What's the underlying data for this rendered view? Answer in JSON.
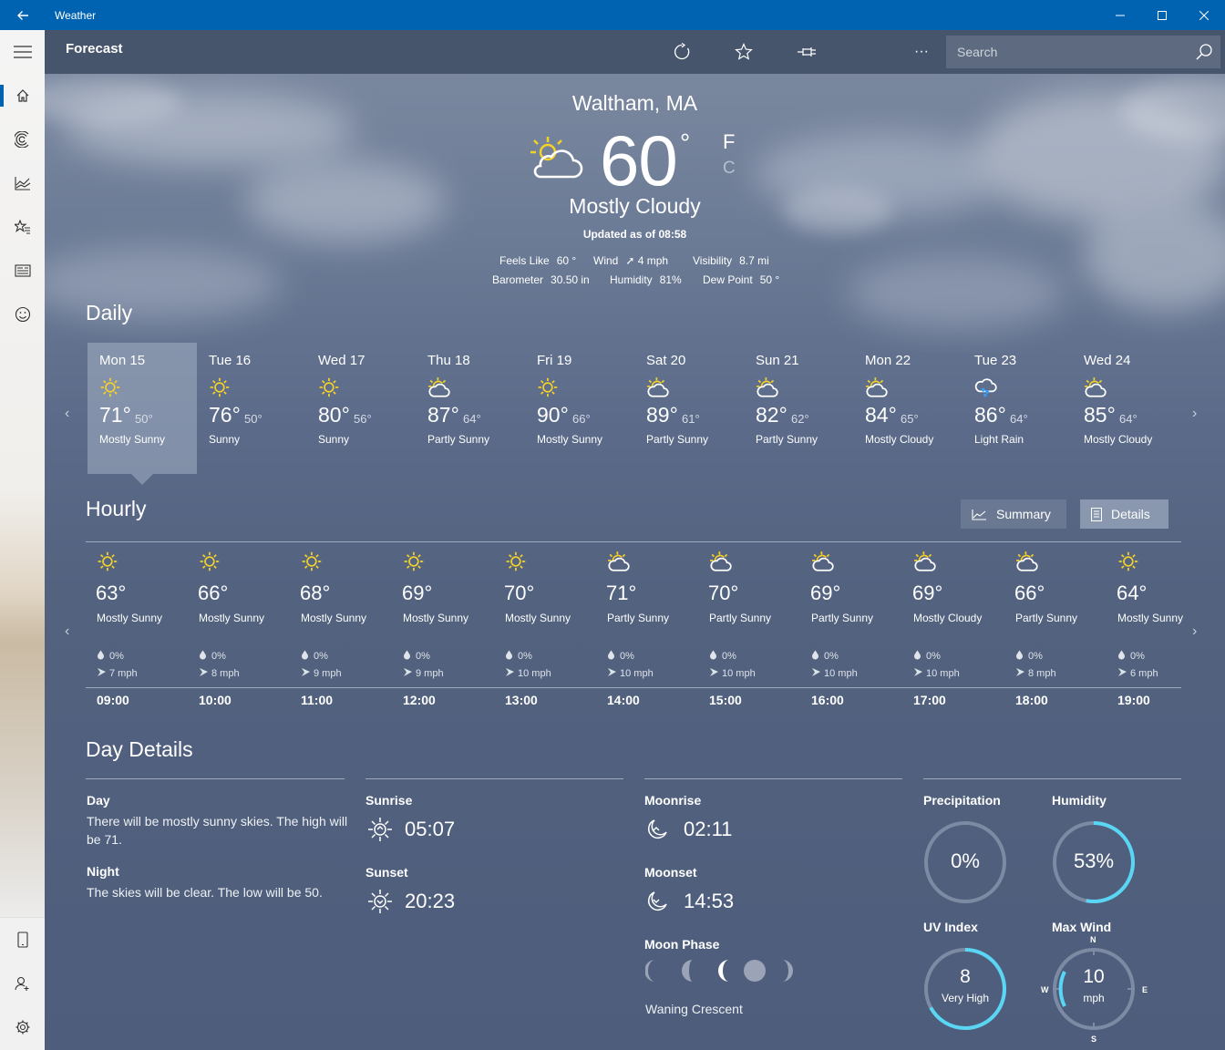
{
  "window": {
    "title": "Weather"
  },
  "header": {
    "title": "Forecast",
    "search_placeholder": "Search"
  },
  "current": {
    "location": "Waltham, MA",
    "temp": "60",
    "deg": "°",
    "unit_f": "F",
    "unit_c": "C",
    "condition": "Mostly Cloudy",
    "updated": "Updated as of 08:58",
    "feels_like_label": "Feels Like",
    "feels_like": "60 °",
    "wind_label": "Wind",
    "wind": "4 mph",
    "visibility_label": "Visibility",
    "visibility": "8.7 mi",
    "barometer_label": "Barometer",
    "barometer": "30.50 in",
    "humidity_label": "Humidity",
    "humidity": "81%",
    "dew_point_label": "Dew Point",
    "dew_point": "50 °"
  },
  "daily": {
    "title": "Daily",
    "days": [
      {
        "name": "Mon 15",
        "hi": "71°",
        "lo": "50°",
        "cond": "Mostly Sunny",
        "icon": "sun"
      },
      {
        "name": "Tue 16",
        "hi": "76°",
        "lo": "50°",
        "cond": "Sunny",
        "icon": "sun"
      },
      {
        "name": "Wed 17",
        "hi": "80°",
        "lo": "56°",
        "cond": "Sunny",
        "icon": "sun"
      },
      {
        "name": "Thu 18",
        "hi": "87°",
        "lo": "64°",
        "cond": "Partly Sunny",
        "icon": "partly"
      },
      {
        "name": "Fri 19",
        "hi": "90°",
        "lo": "66°",
        "cond": "Mostly Sunny",
        "icon": "sun"
      },
      {
        "name": "Sat 20",
        "hi": "89°",
        "lo": "61°",
        "cond": "Partly Sunny",
        "icon": "partly"
      },
      {
        "name": "Sun 21",
        "hi": "82°",
        "lo": "62°",
        "cond": "Partly Sunny",
        "icon": "partly"
      },
      {
        "name": "Mon 22",
        "hi": "84°",
        "lo": "65°",
        "cond": "Mostly Cloudy",
        "icon": "partly"
      },
      {
        "name": "Tue 23",
        "hi": "86°",
        "lo": "64°",
        "cond": "Light Rain",
        "icon": "rain"
      },
      {
        "name": "Wed 24",
        "hi": "85°",
        "lo": "64°",
        "cond": "Mostly Cloudy",
        "icon": "partly"
      }
    ]
  },
  "hourly": {
    "title": "Hourly",
    "summary_label": "Summary",
    "details_label": "Details",
    "hours": [
      {
        "temp": "63°",
        "cond": "Mostly Sunny",
        "precip": "0%",
        "wind": "7 mph",
        "time": "09:00",
        "icon": "sun"
      },
      {
        "temp": "66°",
        "cond": "Mostly Sunny",
        "precip": "0%",
        "wind": "8 mph",
        "time": "10:00",
        "icon": "sun"
      },
      {
        "temp": "68°",
        "cond": "Mostly Sunny",
        "precip": "0%",
        "wind": "9 mph",
        "time": "11:00",
        "icon": "sun"
      },
      {
        "temp": "69°",
        "cond": "Mostly Sunny",
        "precip": "0%",
        "wind": "9 mph",
        "time": "12:00",
        "icon": "sun"
      },
      {
        "temp": "70°",
        "cond": "Mostly Sunny",
        "precip": "0%",
        "wind": "10 mph",
        "time": "13:00",
        "icon": "sun"
      },
      {
        "temp": "71°",
        "cond": "Partly Sunny",
        "precip": "0%",
        "wind": "10 mph",
        "time": "14:00",
        "icon": "partly"
      },
      {
        "temp": "70°",
        "cond": "Partly Sunny",
        "precip": "0%",
        "wind": "10 mph",
        "time": "15:00",
        "icon": "partly"
      },
      {
        "temp": "69°",
        "cond": "Partly Sunny",
        "precip": "0%",
        "wind": "10 mph",
        "time": "16:00",
        "icon": "partly"
      },
      {
        "temp": "69°",
        "cond": "Mostly Cloudy",
        "precip": "0%",
        "wind": "10 mph",
        "time": "17:00",
        "icon": "partly"
      },
      {
        "temp": "66°",
        "cond": "Partly Sunny",
        "precip": "0%",
        "wind": "8 mph",
        "time": "18:00",
        "icon": "partly"
      },
      {
        "temp": "64°",
        "cond": "Mostly Sunny",
        "precip": "0%",
        "wind": "6 mph",
        "time": "19:00",
        "icon": "sun"
      }
    ]
  },
  "day_details": {
    "title": "Day Details",
    "day_label": "Day",
    "day_text": "There will be mostly sunny skies. The high will be 71.",
    "night_label": "Night",
    "night_text": "The skies will be clear. The low will be 50.",
    "sunrise_label": "Sunrise",
    "sunrise": "05:07",
    "sunset_label": "Sunset",
    "sunset": "20:23",
    "moonrise_label": "Moonrise",
    "moonrise": "02:11",
    "moonset_label": "Moonset",
    "moonset": "14:53",
    "moon_phase_label": "Moon Phase",
    "moon_phase": "Waning Crescent",
    "precipitation_label": "Precipitation",
    "precipitation": "0%",
    "precipitation_fraction": 0,
    "humidity_label": "Humidity",
    "humidity": "53%",
    "humidity_fraction": 0.53,
    "uv_label": "UV Index",
    "uv_value": "8",
    "uv_text": "Very High",
    "uv_fraction": 0.67,
    "wind_label": "Max Wind",
    "wind_value": "10",
    "wind_unit": "mph",
    "compass_n": "N",
    "compass_e": "E",
    "compass_s": "S",
    "compass_w": "W",
    "accent": "#5ad6f5"
  },
  "nav": {
    "items": [
      "hamburger-icon",
      "home-icon",
      "radar-icon",
      "chart-icon",
      "favorites-icon",
      "news-icon",
      "feedback-icon"
    ],
    "bottom": [
      "phone-icon",
      "add-account-icon",
      "settings-icon"
    ]
  }
}
